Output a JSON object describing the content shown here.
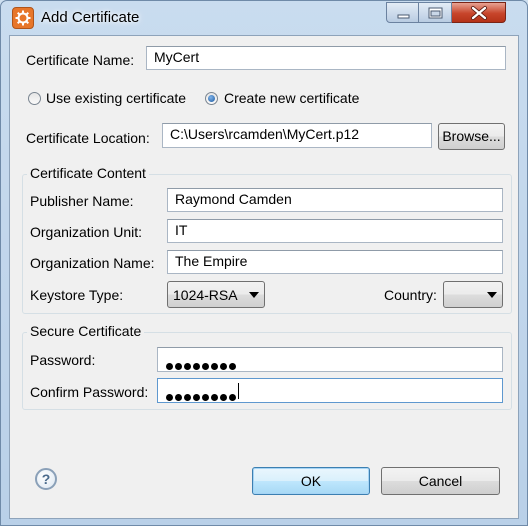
{
  "window": {
    "title": "Add Certificate"
  },
  "titlebar": {
    "minimize_icon": "minimize-icon",
    "maximize_icon": "maximize-icon",
    "close_icon": "close-icon"
  },
  "form": {
    "certificate_name": {
      "label": "Certificate Name:",
      "value": "MyCert"
    },
    "mode": {
      "options": [
        {
          "label": "Use existing certificate",
          "checked": false
        },
        {
          "label": "Create new certificate",
          "checked": true
        }
      ]
    },
    "certificate_location": {
      "label": "Certificate Location:",
      "value": "C:\\Users\\rcamden\\MyCert.p12"
    },
    "browse_label": "Browse..."
  },
  "certificate_content": {
    "title": "Certificate Content",
    "publisher_name": {
      "label": "Publisher Name:",
      "value": "Raymond Camden"
    },
    "organization_unit": {
      "label": "Organization Unit:",
      "value": "IT"
    },
    "organization_name": {
      "label": "Organization Name:",
      "value": "The Empire"
    },
    "keystore_type": {
      "label": "Keystore Type:",
      "value": "1024-RSA"
    },
    "country": {
      "label": "Country:",
      "value": ""
    }
  },
  "secure_certificate": {
    "title": "Secure Certificate",
    "password": {
      "label": "Password:",
      "masked_length": 8
    },
    "confirm_password": {
      "label": "Confirm Password:",
      "masked_length": 8
    }
  },
  "footer": {
    "help_icon": "help-icon",
    "help_glyph": "?",
    "ok_label": "OK",
    "cancel_label": "Cancel"
  },
  "colors": {
    "close_button": "#c7452b",
    "default_button_border": "#3c7fb1",
    "app_icon": "#e7762a"
  }
}
